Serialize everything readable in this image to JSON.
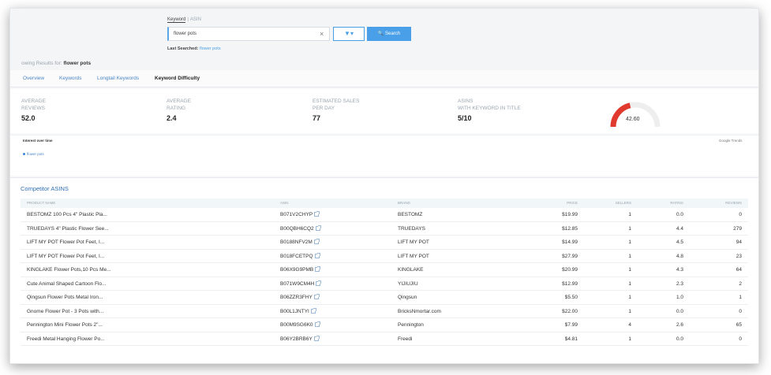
{
  "search": {
    "tab_keyword": "Keyword",
    "tab_asin": "ASIN",
    "query": "flower pots",
    "clear_symbol": "×",
    "filter_label": "▼▾",
    "search_label": "🔍 Search",
    "last_searched_label": "Last Searched:",
    "last_searched_value": "flower pots"
  },
  "results": {
    "prefix": "owing Results for:",
    "keyword": "flower pots"
  },
  "tabs": [
    "Overview",
    "Keywords",
    "Longtail Keywords",
    "Keyword Difficulty"
  ],
  "active_tab": "Keyword Difficulty",
  "stats": [
    {
      "label_line1": "AVERAGE",
      "label_line2": "REVIEWS",
      "value": "52.0"
    },
    {
      "label_line1": "AVERAGE",
      "label_line2": "RATING",
      "value": "2.4"
    },
    {
      "label_line1": "ESTIMATED SALES",
      "label_line2": "PER DAY",
      "value": "77"
    },
    {
      "label_line1": "ASINS",
      "label_line2": "WITH KEYWORD IN TITLE",
      "value": "5/10"
    }
  ],
  "gauge": {
    "value": "42.60",
    "fraction": 0.426,
    "color": "#e03a2f",
    "track": "#eeeeee"
  },
  "interest": {
    "title": "Interest over time",
    "legend": "flower pots",
    "source": "Google Trends"
  },
  "competitors": {
    "title": "Competitor ASINS",
    "columns": [
      "PRODUCT NAME",
      "ASIN",
      "BRAND",
      "PRICE",
      "SELLERS",
      "RATING",
      "REVIEWS"
    ],
    "rows": [
      {
        "name": "BESTOMZ 100 Pcs 4\" Plastic Pla...",
        "asin": "B071V2CHYP",
        "brand": "BESTOMZ",
        "price": "$19.99",
        "sellers": "1",
        "rating": "0.0",
        "reviews": "0"
      },
      {
        "name": "TRUEDAYS 4\" Plastic Flower See...",
        "asin": "B00QBH6CQ2",
        "brand": "TRUEDAYS",
        "price": "$12.85",
        "sellers": "1",
        "rating": "4.4",
        "reviews": "279"
      },
      {
        "name": "LIFT MY POT Flower Pot Feet, I...",
        "asin": "B0188NFV2M",
        "brand": "LIFT MY POT",
        "price": "$14.99",
        "sellers": "1",
        "rating": "4.5",
        "reviews": "94"
      },
      {
        "name": "LIFT MY POT Flower Pot Feet, I...",
        "asin": "B018FCETPQ",
        "brand": "LIFT MY POT",
        "price": "$27.99",
        "sellers": "1",
        "rating": "4.8",
        "reviews": "23"
      },
      {
        "name": "KINGLAKE Flower Pots,10 Pcs Me...",
        "asin": "B06X9G9PMB",
        "brand": "KINGLAKE",
        "price": "$20.99",
        "sellers": "1",
        "rating": "4.3",
        "reviews": "64"
      },
      {
        "name": "Cute Animal Shaped Cartoon Flo...",
        "asin": "B071W9CM4H",
        "brand": "YIJIUJIU",
        "price": "$12.99",
        "sellers": "1",
        "rating": "2.3",
        "reviews": "2"
      },
      {
        "name": "Qingsun Flower Pots Metal Iron...",
        "asin": "B06ZZR3FHY",
        "brand": "Qingsun",
        "price": "$5.50",
        "sellers": "1",
        "rating": "1.0",
        "reviews": "1"
      },
      {
        "name": "Gnome Flower Pot - 3 Pots with...",
        "asin": "B00L1JNTYI",
        "brand": "BricksNmortar.com",
        "price": "$22.00",
        "sellers": "1",
        "rating": "0.0",
        "reviews": "0"
      },
      {
        "name": "Pennington Mini Flower Pots 2\"...",
        "asin": "B00M9SG6K0",
        "brand": "Pennington",
        "price": "$7.99",
        "sellers": "4",
        "rating": "2.6",
        "reviews": "65"
      },
      {
        "name": "Freedi Metal Hanging Flower Po...",
        "asin": "B06Y2BRB6Y",
        "brand": "Freedi",
        "price": "$4.81",
        "sellers": "1",
        "rating": "0.0",
        "reviews": "0"
      }
    ]
  }
}
